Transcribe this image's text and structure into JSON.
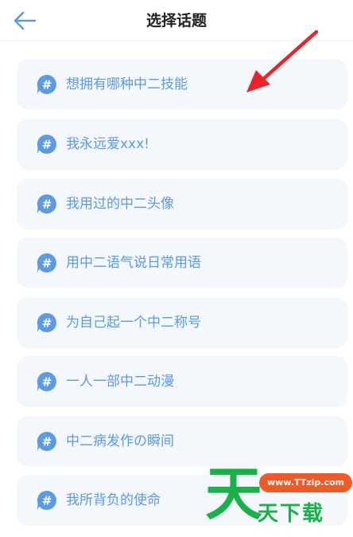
{
  "header": {
    "title": "选择话题",
    "back_icon": "arrow-left-icon"
  },
  "topics": [
    {
      "label": "想拥有哪种中二技能",
      "icon": "hashtag-bubble-icon"
    },
    {
      "label": "我永远爱xxx!",
      "icon": "hashtag-bubble-icon"
    },
    {
      "label": "我用过的中二头像",
      "icon": "hashtag-bubble-icon"
    },
    {
      "label": "用中二语气说日常用语",
      "icon": "hashtag-bubble-icon"
    },
    {
      "label": "为自己起一个中二称号",
      "icon": "hashtag-bubble-icon"
    },
    {
      "label": "一人一部中二动漫",
      "icon": "hashtag-bubble-icon"
    },
    {
      "label": "中二病发作の瞬间",
      "icon": "hashtag-bubble-icon"
    },
    {
      "label": "我所背负的使命",
      "icon": "hashtag-bubble-icon"
    }
  ],
  "watermark": {
    "big_char": "天",
    "url": "www.TTzip.com",
    "text": "天下载"
  },
  "colors": {
    "accent": "#5b9ae4",
    "item_bg": "#f4f7fc",
    "annotation_arrow": "#e8232a",
    "watermark_green": "#19b14a",
    "watermark_orange": "#f05a28"
  }
}
